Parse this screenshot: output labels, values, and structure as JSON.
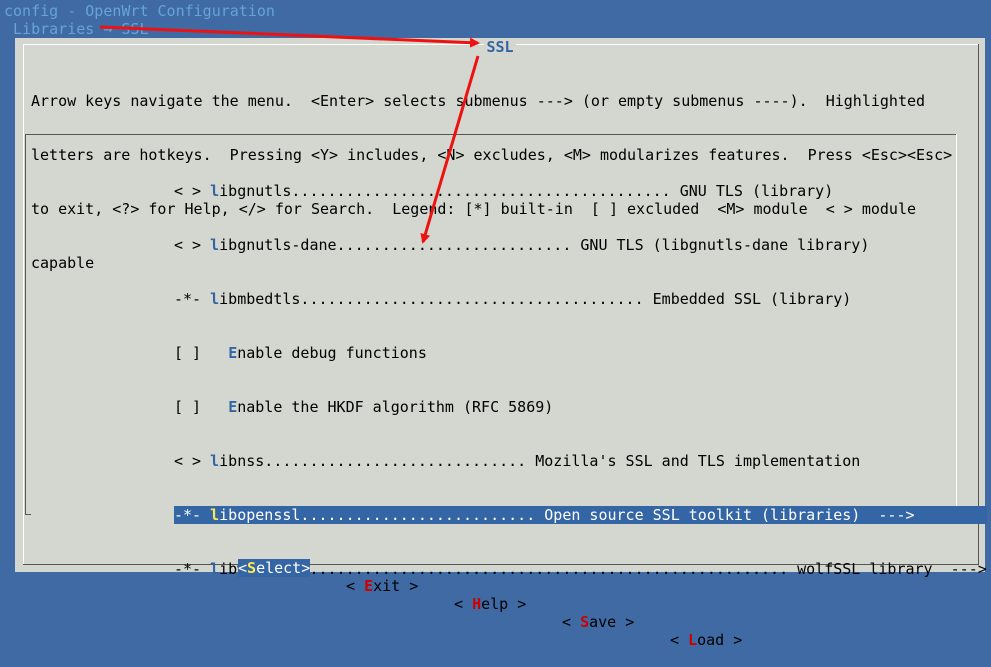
{
  "header": {
    "line1": "config - OpenWrt Configuration",
    "line2": " Libraries → SSL"
  },
  "dialog": {
    "title": "SSL",
    "help_lines": [
      "Arrow keys navigate the menu.  <Enter> selects submenus ---> (or empty submenus ----).  Highlighted",
      "letters are hotkeys.  Pressing <Y> includes, <N> excludes, <M> modularizes features.  Press <Esc><Esc>",
      "to exit, <?> for Help, </> for Search.  Legend: [*] built-in  [ ] excluded  <M> module  < > module",
      "capable"
    ]
  },
  "menu": {
    "items": [
      {
        "prefix": "< > ",
        "hotkey": "l",
        "rest": "ibgnutls.......................................... GNU TLS (library)",
        "suffix": ""
      },
      {
        "prefix": "< > ",
        "hotkey": "l",
        "rest": "ibgnutls-dane.......................... GNU TLS (libgnutls-dane library)",
        "suffix": ""
      },
      {
        "prefix": "-*- ",
        "hotkey": "l",
        "rest": "ibmbedtls...................................... Embedded SSL (library)",
        "suffix": ""
      },
      {
        "prefix": "[ ]   ",
        "hotkey": "E",
        "rest": "nable debug functions",
        "suffix": ""
      },
      {
        "prefix": "[ ]   ",
        "hotkey": "E",
        "rest": "nable the HKDF algorithm (RFC 5869)",
        "suffix": ""
      },
      {
        "prefix": "< > ",
        "hotkey": "l",
        "rest": "ibnss............................. Mozilla's SSL and TLS implementation",
        "suffix": ""
      },
      {
        "prefix": "-*- ",
        "hotkey": "l",
        "rest": "ibopenssl.......................... Open source SSL toolkit (libraries)",
        "suffix": "  --->",
        "selected": true
      },
      {
        "prefix": "-*- ",
        "hotkey": "l",
        "rest": "ibwolfssl...................................................... wolfSSL library",
        "suffix": "  --->"
      }
    ]
  },
  "buttons": [
    {
      "open": "<",
      "hotkey": "S",
      "rest": "elect",
      "close": ">",
      "active": true
    },
    {
      "open": "< ",
      "hotkey": "E",
      "rest": "xit",
      "close": " >",
      "active": false
    },
    {
      "open": "< ",
      "hotkey": "H",
      "rest": "elp",
      "close": " >",
      "active": false
    },
    {
      "open": "< ",
      "hotkey": "S",
      "rest": "ave",
      "close": " >",
      "active": false
    },
    {
      "open": "< ",
      "hotkey": "L",
      "rest": "oad",
      "close": " >",
      "active": false
    }
  ],
  "colors": {
    "background": "#3f6aa3",
    "dialog": "#d3d7cf",
    "highlight": "#3465a4",
    "hotkey": "#3465a4",
    "annotation_arrow": "#ee1111"
  },
  "annotation": {
    "type": "red-arrows",
    "description_icon": "arrow-annotation-icon"
  }
}
